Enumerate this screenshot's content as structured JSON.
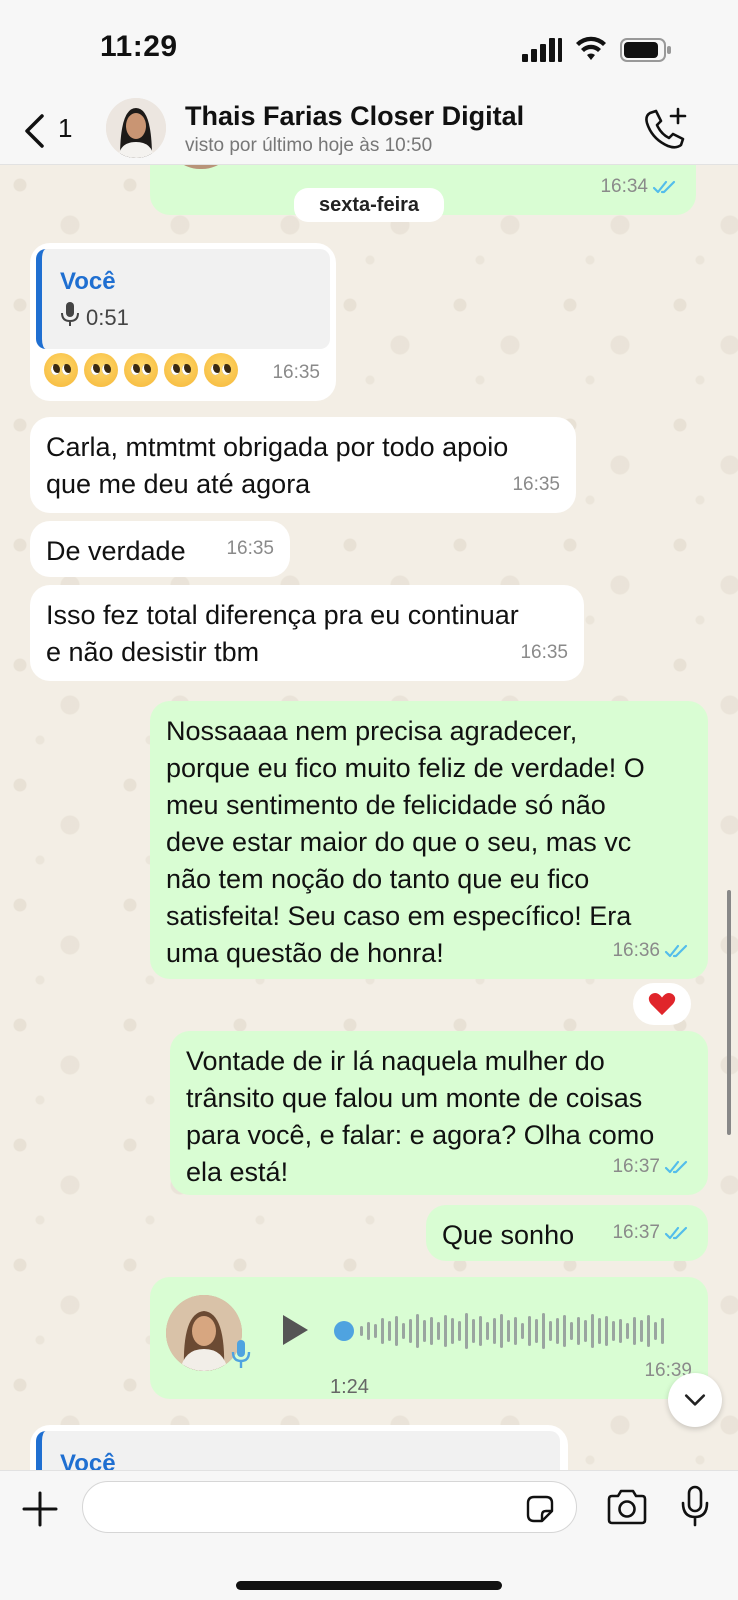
{
  "status_bar": {
    "time": "11:29"
  },
  "header": {
    "back_count": "1",
    "contact_name": "Thais Farias Closer Digital",
    "last_seen": "visto por último hoje às 10:50"
  },
  "chat": {
    "day_separator": "sexta-feira",
    "top_partial_time": "16:34",
    "quoted_message": {
      "author": "Você",
      "duration": "0:51",
      "emojis": "🥺🥺🥺🥺🥺",
      "time": "16:35"
    },
    "messages": [
      {
        "text_lines": [
          "Carla, mtmtmt obrigada por todo apoio",
          "que me deu até agora"
        ],
        "time": "16:35",
        "direction": "in"
      },
      {
        "text_lines": [
          "De verdade"
        ],
        "time": "16:35",
        "direction": "in"
      },
      {
        "text_lines": [
          "Isso fez total diferença pra eu continuar",
          "e não desistir tbm"
        ],
        "time": "16:35",
        "direction": "in"
      },
      {
        "text_lines": [
          "Nossaaaa nem precisa agradecer,",
          "porque eu fico muito feliz de verdade! O",
          "meu sentimento de felicidade só não",
          "deve estar maior do que o seu, mas vc",
          "não tem noção do tanto que eu fico",
          "satisfeita! Seu caso em específico! Era",
          "uma questão de honra!"
        ],
        "time": "16:36",
        "direction": "out",
        "reaction": "❤️"
      },
      {
        "text_lines": [
          "Vontade de ir lá naquela mulher do",
          "trânsito que falou um monte de coisas",
          "para você, e falar: e agora? Olha como",
          "ela está!"
        ],
        "time": "16:37",
        "direction": "out"
      },
      {
        "text_lines": [
          "Que sonho"
        ],
        "time": "16:37",
        "direction": "out"
      }
    ],
    "voice_message": {
      "duration": "1:24",
      "time": "16:39"
    },
    "bottom_quote_author": "Você"
  },
  "colors": {
    "outgoing": "#d9fdd3",
    "incoming": "#ffffff",
    "read_ticks": "#53bdeb",
    "quote_accent": "#1f6fd1"
  },
  "icons": [
    "back-icon",
    "add-call-icon",
    "play-icon",
    "plus-icon",
    "sticker-icon",
    "camera-icon",
    "mic-icon",
    "chevron-down-icon"
  ]
}
